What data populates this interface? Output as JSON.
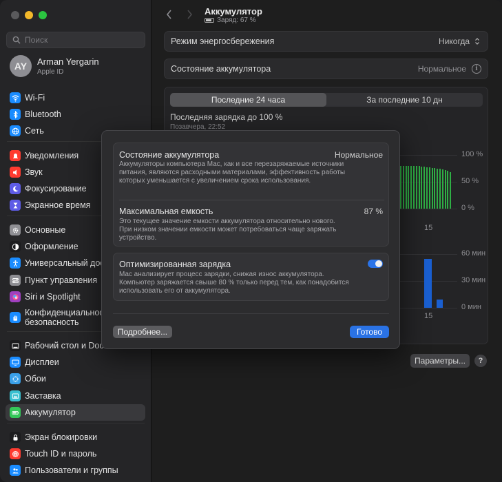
{
  "sidebar": {
    "search_placeholder": "Поиск",
    "user": {
      "initials": "AY",
      "name": "Arman Yergarin",
      "subtitle": "Apple ID"
    },
    "items": [
      {
        "label": "Wi-Fi",
        "icon": "wifi-icon",
        "color": "#1a8cff"
      },
      {
        "label": "Bluetooth",
        "icon": "bluetooth-icon",
        "color": "#1a8cff"
      },
      {
        "label": "Сеть",
        "icon": "globe-icon",
        "color": "#1a8cff"
      },
      {
        "label": "Уведомления",
        "icon": "bell-icon",
        "color": "#ff3b30"
      },
      {
        "label": "Звук",
        "icon": "speaker-icon",
        "color": "#ff3b30"
      },
      {
        "label": "Фокусирование",
        "icon": "moon-icon",
        "color": "#5e5ce6"
      },
      {
        "label": "Экранное время",
        "icon": "hourglass-icon",
        "color": "#5e5ce6"
      },
      {
        "label": "Основные",
        "icon": "gear-icon",
        "color": "#8e8e93"
      },
      {
        "label": "Оформление",
        "icon": "appearance-icon",
        "color": "#1c1c1e"
      },
      {
        "label": "Универсальный доступ",
        "icon": "accessibility-icon",
        "color": "#1a8cff"
      },
      {
        "label": "Пункт управления",
        "icon": "control-center-icon",
        "color": "#8e8e93"
      },
      {
        "label": "Siri и Spotlight",
        "icon": "siri-icon",
        "color": "#a040c0"
      },
      {
        "label": "Конфиденциальность и безопасность",
        "icon": "hand-icon",
        "color": "#1a8cff"
      },
      {
        "label": "Рабочий стол и Dock",
        "icon": "dock-icon",
        "color": "#1c1c1e"
      },
      {
        "label": "Дисплеи",
        "icon": "display-icon",
        "color": "#1a8cff"
      },
      {
        "label": "Обои",
        "icon": "wallpaper-icon",
        "color": "#3aa0e8"
      },
      {
        "label": "Заставка",
        "icon": "screensaver-icon",
        "color": "#3ac0d0"
      },
      {
        "label": "Аккумулятор",
        "icon": "battery-icon",
        "color": "#34c759"
      },
      {
        "label": "Экран блокировки",
        "icon": "lock-icon",
        "color": "#1c1c1e"
      },
      {
        "label": "Touch ID и пароль",
        "icon": "fingerprint-icon",
        "color": "#ff3b30"
      },
      {
        "label": "Пользователи и группы",
        "icon": "users-icon",
        "color": "#1a8cff"
      }
    ]
  },
  "header": {
    "title": "Аккумулятор",
    "subtitle": "Заряд: 67 %"
  },
  "settings": {
    "low_power": {
      "label": "Режим энергосбережения",
      "value": "Никогда"
    },
    "health": {
      "label": "Состояние аккумулятора",
      "value": "Нормальное"
    }
  },
  "usage": {
    "tabs": [
      "Последние 24 часа",
      "За последние 10 дн"
    ],
    "last_charge": "Последняя зарядка до 100 %",
    "last_charge_time": "Позавчера, 22:52",
    "level_axis": [
      "100 %",
      "50 %",
      "0 %"
    ],
    "activity_axis": [
      "60 мин",
      "30 мин",
      "0 мин"
    ],
    "x_tick": "15"
  },
  "chart_data": [
    {
      "type": "bar",
      "title": "",
      "x_tick_labels": [
        "15"
      ],
      "y_tick_labels": [
        "100 %",
        "50 %",
        "0 %"
      ],
      "ylim": [
        0,
        100
      ],
      "values": [
        79,
        79,
        79,
        79,
        79,
        79,
        79,
        79,
        78,
        78,
        77,
        77,
        76,
        76,
        75,
        74,
        73,
        72,
        70,
        68
      ],
      "color": "#2fae45"
    },
    {
      "type": "bar",
      "title": "",
      "x_tick_labels": [
        "15"
      ],
      "y_tick_labels": [
        "60 мин",
        "30 мин",
        "0 мин"
      ],
      "ylim": [
        0,
        60
      ],
      "values": [
        55,
        9
      ],
      "color": "#1a5fd0"
    }
  ],
  "footer": {
    "params_label": "Параметры...",
    "help_label": "?"
  },
  "modal": {
    "health_title": "Состояние аккумулятора",
    "health_value": "Нормальное",
    "health_desc": "Аккумуляторы компьютера Mac, как и все перезаряжаемые источники питания, являются расходными материалами, эффективность работы которых уменьшается с увеличением срока использования.",
    "capacity_title": "Максимальная емкость",
    "capacity_value": "87 %",
    "capacity_desc": "Это текущее значение емкости аккумулятора относительно нового. При низком значении емкости может потребоваться чаще заряжать устройство.",
    "optimized_title": "Оптимизированная зарядка",
    "optimized_on": true,
    "optimized_desc": "Mac анализирует процесс зарядки, снижая износ аккумулятора. Компьютер заряжается свыше 80 % только перед тем, как понадобится использовать его от аккумулятора.",
    "more_label": "Подробнее...",
    "done_label": "Готово"
  }
}
